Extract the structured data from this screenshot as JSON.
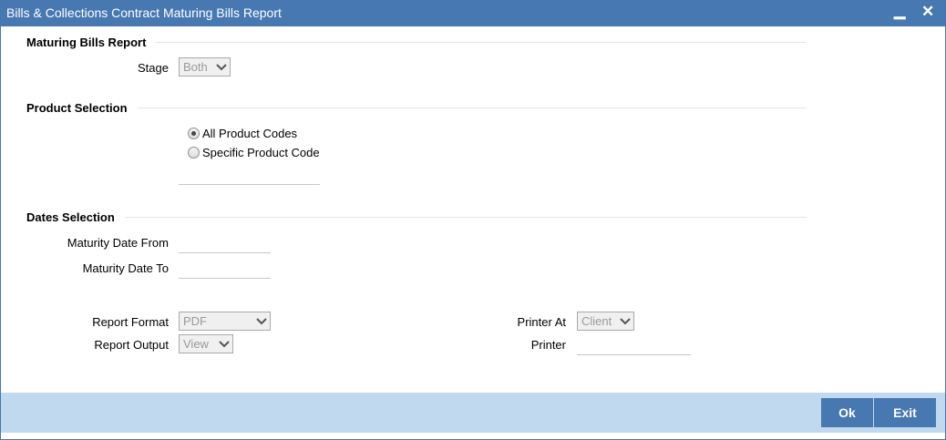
{
  "window": {
    "title": "Bills & Collections Contract Maturing Bills Report",
    "minimize_glyph": "▁",
    "close_glyph": "✕"
  },
  "maturing": {
    "section_title": "Maturing Bills Report",
    "stage_label": "Stage",
    "stage_value": "Both"
  },
  "product": {
    "section_title": "Product Selection",
    "options": [
      "All Product Codes",
      "Specific Product Code"
    ],
    "selected": "All Product Codes",
    "product_code_value": ""
  },
  "dates": {
    "section_title": "Dates Selection",
    "from_label": "Maturity Date From",
    "from_value": "",
    "to_label": "Maturity Date To",
    "to_value": ""
  },
  "report": {
    "format_label": "Report Format",
    "format_value": "PDF",
    "output_label": "Report Output",
    "output_value": "View",
    "printer_at_label": "Printer At",
    "printer_at_value": "Client",
    "printer_label": "Printer",
    "printer_value": ""
  },
  "footer": {
    "ok_label": "Ok",
    "exit_label": "Exit"
  },
  "colors": {
    "titlebar": "#4778b2",
    "footer": "#c0d9ee",
    "button": "#4778b2"
  }
}
